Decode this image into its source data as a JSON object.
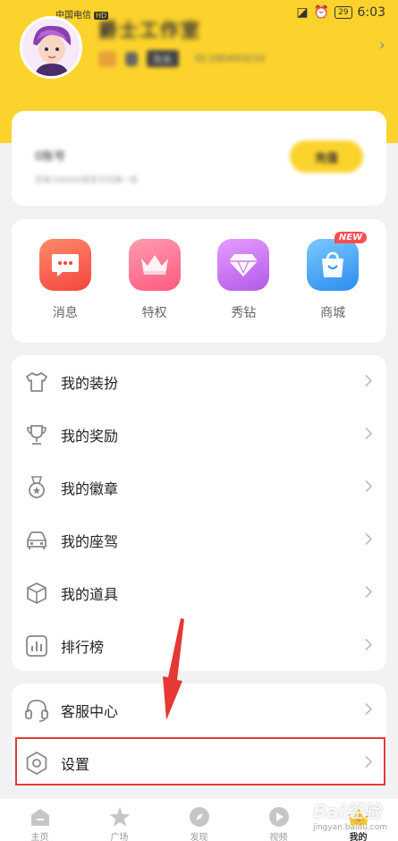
{
  "status_bar": {
    "carrier": "中国电信",
    "carrier_badge": "HD",
    "battery": "29",
    "time": "6:03"
  },
  "profile": {
    "username": "爵士工作室",
    "tag": "队长",
    "uid": "ID:180493210"
  },
  "account": {
    "label": "0账号",
    "sub": "还有100000发至可兑换一些",
    "button_label": "充值"
  },
  "shortcuts": [
    {
      "label": "消息",
      "icon": "message-icon",
      "color": "#ff5a4e"
    },
    {
      "label": "特权",
      "icon": "crown-icon",
      "color": "#ff6f8e"
    },
    {
      "label": "秀钻",
      "icon": "diamond-icon",
      "color": "#c86bf0"
    },
    {
      "label": "商城",
      "icon": "shopping-bag-icon",
      "color": "#3fa8ff",
      "badge": "NEW"
    }
  ],
  "menu": [
    {
      "label": "我的装扮",
      "icon": "tshirt-icon"
    },
    {
      "label": "我的奖励",
      "icon": "trophy-icon"
    },
    {
      "label": "我的徽章",
      "icon": "medal-icon"
    },
    {
      "label": "我的座驾",
      "icon": "car-icon"
    },
    {
      "label": "我的道具",
      "icon": "box-icon"
    },
    {
      "label": "排行榜",
      "icon": "chart-icon"
    }
  ],
  "menu2": [
    {
      "label": "客服中心",
      "icon": "headset-icon"
    },
    {
      "label": "设置",
      "icon": "settings-icon"
    }
  ],
  "tabs": [
    {
      "label": "主页",
      "icon": "home-icon"
    },
    {
      "label": "广场",
      "icon": "star-icon"
    },
    {
      "label": "发现",
      "icon": "compass-icon"
    },
    {
      "label": "视频",
      "icon": "play-icon"
    },
    {
      "label": "我的",
      "icon": "profile-icon",
      "active": true
    }
  ],
  "watermark": {
    "text": "Bai经验",
    "url": "jingyan.baidu.com"
  },
  "colors": {
    "accent": "#fcd32c",
    "highlight": "#e53935"
  }
}
